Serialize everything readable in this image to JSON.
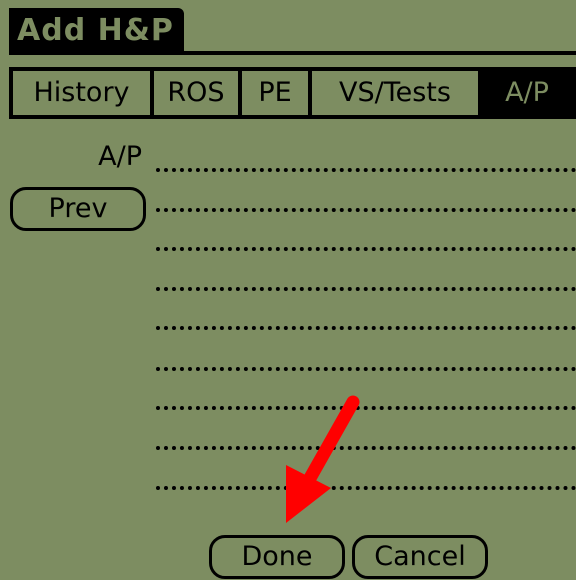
{
  "app": {
    "title": "Add H&P"
  },
  "tabs": [
    {
      "label": "History",
      "selected": false
    },
    {
      "label": "ROS",
      "selected": false
    },
    {
      "label": "PE",
      "selected": false
    },
    {
      "label": "VS/Tests",
      "selected": false
    },
    {
      "label": "A/P",
      "selected": true
    }
  ],
  "form": {
    "field_label": "A/P",
    "prev_label": "Prev",
    "note_value": ""
  },
  "buttons": {
    "done_label": "Done",
    "cancel_label": "Cancel"
  },
  "colors": {
    "screen_background": "#7d8d61",
    "ink": "#000000",
    "annotation_arrow": "#ff0000"
  },
  "icons": {
    "annotation": "red-arrow-icon"
  }
}
